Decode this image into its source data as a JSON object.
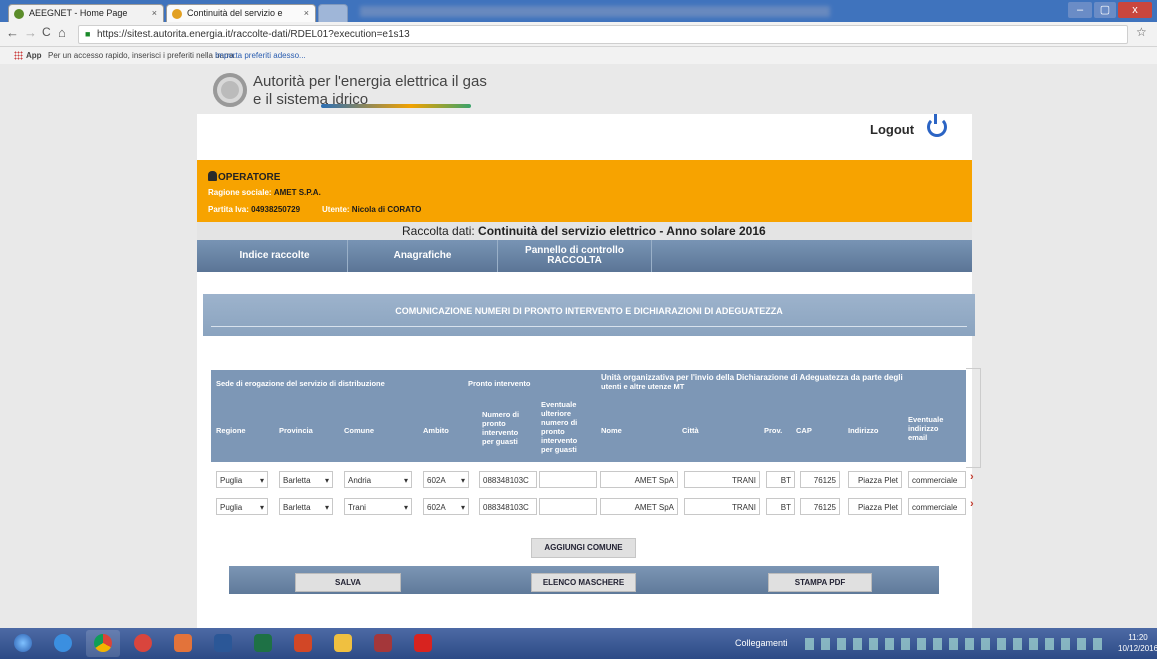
{
  "browser": {
    "tabs": [
      {
        "title": "AEEGNET - Home Page",
        "close": "×"
      },
      {
        "title": "Continuità del servizio e",
        "close": "×"
      }
    ],
    "url": "https://sitest.autorita.energia.it/raccolte-dati/RDEL01?execution=e1s13",
    "bookmarks": {
      "apps_label": "App",
      "hint": "Per un accesso rapido, inserisci i preferiti nella barra.",
      "import_link": "Importa preferiti adesso..."
    },
    "nav": {
      "back": "←",
      "forward": "→",
      "reload": "C",
      "home": "⌂",
      "star": "☆"
    },
    "window": {
      "minimize": "–",
      "maximize": "▢",
      "close": "x"
    }
  },
  "site": {
    "brand_line1": "Autorità per l'energia elettrica il gas",
    "brand_line2": "e il sistema idrico",
    "logout": "Logout"
  },
  "operator": {
    "title": "OPERATORE",
    "ragione_label": "Ragione sociale:",
    "ragione_value": "AMET S.P.A.",
    "piva_label": "Partita Iva:",
    "piva_value": "04938250729",
    "utente_label": "Utente:",
    "utente_value": "Nicola di CORATO"
  },
  "raccolta": {
    "label": "Raccolta dati:",
    "value": "Continuità del servizio elettrico - Anno solare 2016"
  },
  "menu": [
    "Indice raccolte",
    "Anagrafiche",
    "Pannello di controllo",
    "RACCOLTA"
  ],
  "section_title": "COMUNICAZIONE NUMERI DI PRONTO INTERVENTO E DICHIARAZIONI DI ADEGUATEZZA",
  "table": {
    "group_headers": {
      "sede": "Sede di erogazione del servizio di distribuzione",
      "pronto": "Pronto intervento",
      "unita_1": "Unità organizzativa per l'invio della Dichiarazione di Adeguatezza da parte degli",
      "unita_2": "utenti e altre utenze MT"
    },
    "columns": {
      "regione": "Regione",
      "provincia": "Provincia",
      "comune": "Comune",
      "ambito": "Ambito",
      "numero": [
        "Numero di",
        "pronto",
        "intervento",
        "per guasti"
      ],
      "eventuale": [
        "Eventuale",
        "ulteriore",
        "numero di",
        "pronto",
        "intervento",
        "per guasti"
      ],
      "nome": "Nome",
      "citta": "Città",
      "prov": "Prov.",
      "cap": "CAP",
      "indirizzo": "Indirizzo",
      "email": [
        "Eventuale",
        "indirizzo",
        "email"
      ]
    },
    "rows": [
      {
        "regione": "Puglia",
        "provincia": "Barletta",
        "comune": "Andria",
        "ambito": "602A",
        "numero": "088348103C",
        "eventuale": "",
        "nome": "AMET SpA",
        "citta": "TRANI",
        "prov": "BT",
        "cap": "76125",
        "indirizzo": "Piazza Plet",
        "email": "commerciale"
      },
      {
        "regione": "Puglia",
        "provincia": "Barletta",
        "comune": "Trani",
        "ambito": "602A",
        "numero": "088348103C",
        "eventuale": "",
        "nome": "AMET SpA",
        "citta": "TRANI",
        "prov": "BT",
        "cap": "76125",
        "indirizzo": "Piazza Plet",
        "email": "commerciale"
      }
    ],
    "row_action": "›"
  },
  "buttons": {
    "aggiungi": "AGGIUNGI COMUNE",
    "salva": "SALVA",
    "elenco": "ELENCO MASCHERE",
    "stampa": "STAMPA PDF"
  },
  "taskbar": {
    "tray_label": "Collegamenti",
    "time": "11:20",
    "date": "10/12/2016"
  }
}
